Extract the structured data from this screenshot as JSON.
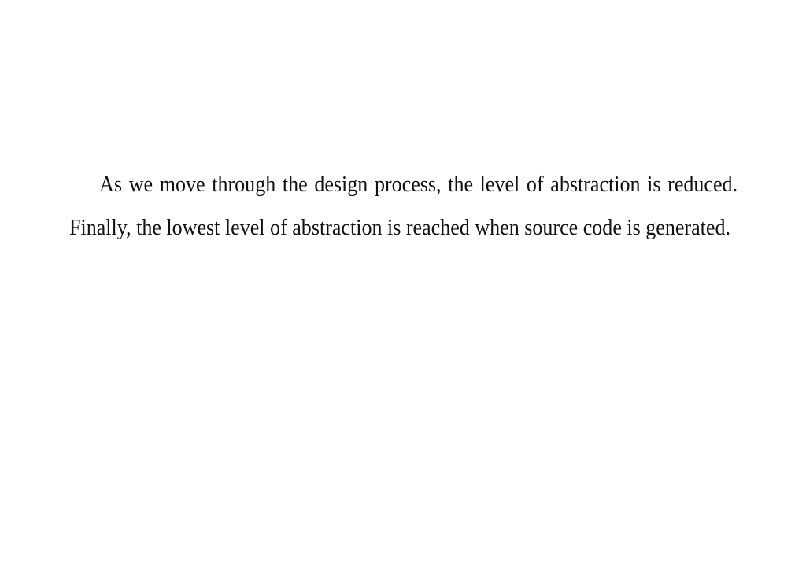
{
  "document": {
    "paragraph": "As we move through the design process, the level of abstraction is reduced. Finally, the lowest level of abstraction is reached when source code is generated."
  }
}
